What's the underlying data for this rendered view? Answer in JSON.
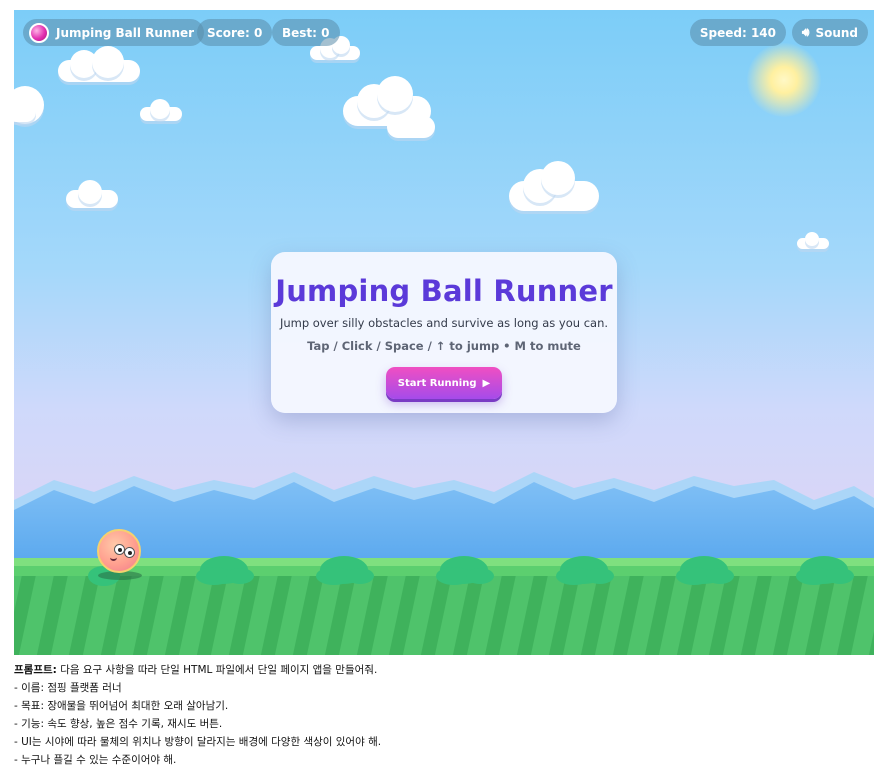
{
  "hud": {
    "title": "Jumping Ball Runner",
    "score": "Score: 0",
    "best": "Best: 0",
    "speed": "Speed: 140",
    "sound": "Sound",
    "sound_icon": "speaker-icon"
  },
  "panel": {
    "title": "Jumping Ball Runner",
    "subtitle": "Jump over silly obstacles and survive as long as you can.",
    "controls": "Tap / Click / Space / ↑ to jump • M to mute",
    "start_label": "Start Running",
    "start_icon": "play-icon"
  },
  "prompt": {
    "label": "프롬프트:",
    "intro": "다음 요구 사항을 따라 단일 HTML 파일에서 단일 페이지 앱을 만들어줘.",
    "lines": [
      "- 이름: 점핑 플랫폼 러너",
      "- 목표: 장애물을 뛰어넘어 최대한 오래 살아남기.",
      "- 기능: 속도 향상, 높은 점수 기록, 재시도 버튼.",
      "- UI는 시야에 따라 물체의 위치나 방향이 달라지는 배경에 다양한 색상이 있어야 해.",
      "- 누구나 플길 수 있는 수준이어야 해."
    ]
  },
  "colors": {
    "sky_top": "#7ccdf8",
    "grass": "#4cc66a",
    "title_purple": "#5b3ad9",
    "button_pink": "#f04fc2",
    "button_purple": "#a54bea"
  }
}
